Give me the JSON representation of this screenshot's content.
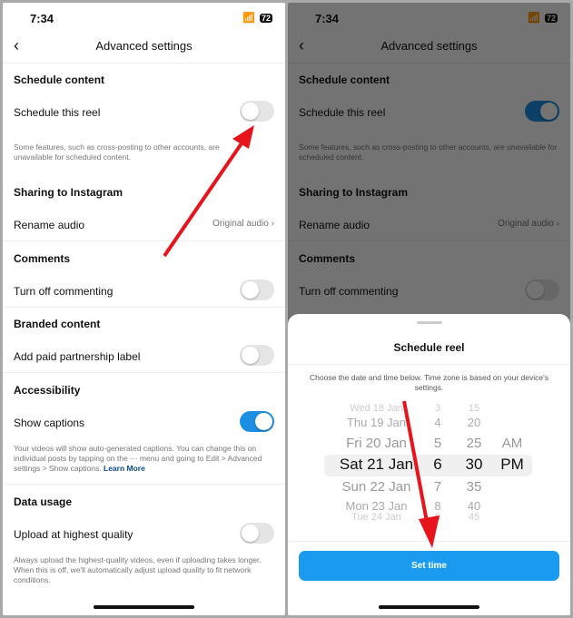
{
  "status": {
    "time": "7:34",
    "battery": "72"
  },
  "header": {
    "title": "Advanced settings"
  },
  "sections": {
    "schedule": {
      "title": "Schedule content",
      "item": "Schedule this reel",
      "note": "Some features, such as cross-posting to other accounts, are unavailable for scheduled content.",
      "note_left": "Some features, such as cross-posting to other accounts",
      "note_left2": "unavailable for scheduled content."
    },
    "sharing": {
      "title": "Sharing to Instagram",
      "item": "Rename audio",
      "value": "Original audio"
    },
    "comments": {
      "title": "Comments",
      "item": "Turn off commenting"
    },
    "branded": {
      "title": "Branded content",
      "item": "Add paid partnership label"
    },
    "accessibility": {
      "title": "Accessibility",
      "item": "Show captions",
      "note": "Your videos will show auto-generated captions. You can change this on individual posts by tapping on the ··· menu and going to Edit > Advanced settings > Show captions.",
      "link": "Learn More"
    },
    "data": {
      "title": "Data usage",
      "item": "Upload at highest quality",
      "note": "Always upload the highest-quality videos, even if uploading takes longer. When this is off, we'll automatically adjust upload quality to fit network conditions."
    }
  },
  "toggles": {
    "left": {
      "schedule": false,
      "commenting": false,
      "partnership": false,
      "captions": true,
      "quality": false
    },
    "right": {
      "schedule": true,
      "commenting": false
    }
  },
  "sheet": {
    "title": "Schedule reel",
    "description": "Choose the date and time below. Time zone is based on your device's settings.",
    "button": "Set time",
    "dates": [
      "Wed 18 Jan",
      "Thu 19 Jan",
      "Fri 20 Jan",
      "Sat 21 Jan",
      "Sun 22 Jan",
      "Mon 23 Jan",
      "Tue 24 Jan"
    ],
    "hours": [
      "3",
      "4",
      "5",
      "6",
      "7",
      "8",
      "9"
    ],
    "minutes": [
      "15",
      "20",
      "25",
      "30",
      "35",
      "40",
      "45"
    ],
    "ampm": [
      "AM",
      "PM"
    ],
    "selected": {
      "date": "Sat 21 Jan",
      "hour": "6",
      "minute": "30",
      "ampm": "PM"
    }
  },
  "colors": {
    "accent": "#1a9bf0",
    "arrow": "#e8141b"
  }
}
